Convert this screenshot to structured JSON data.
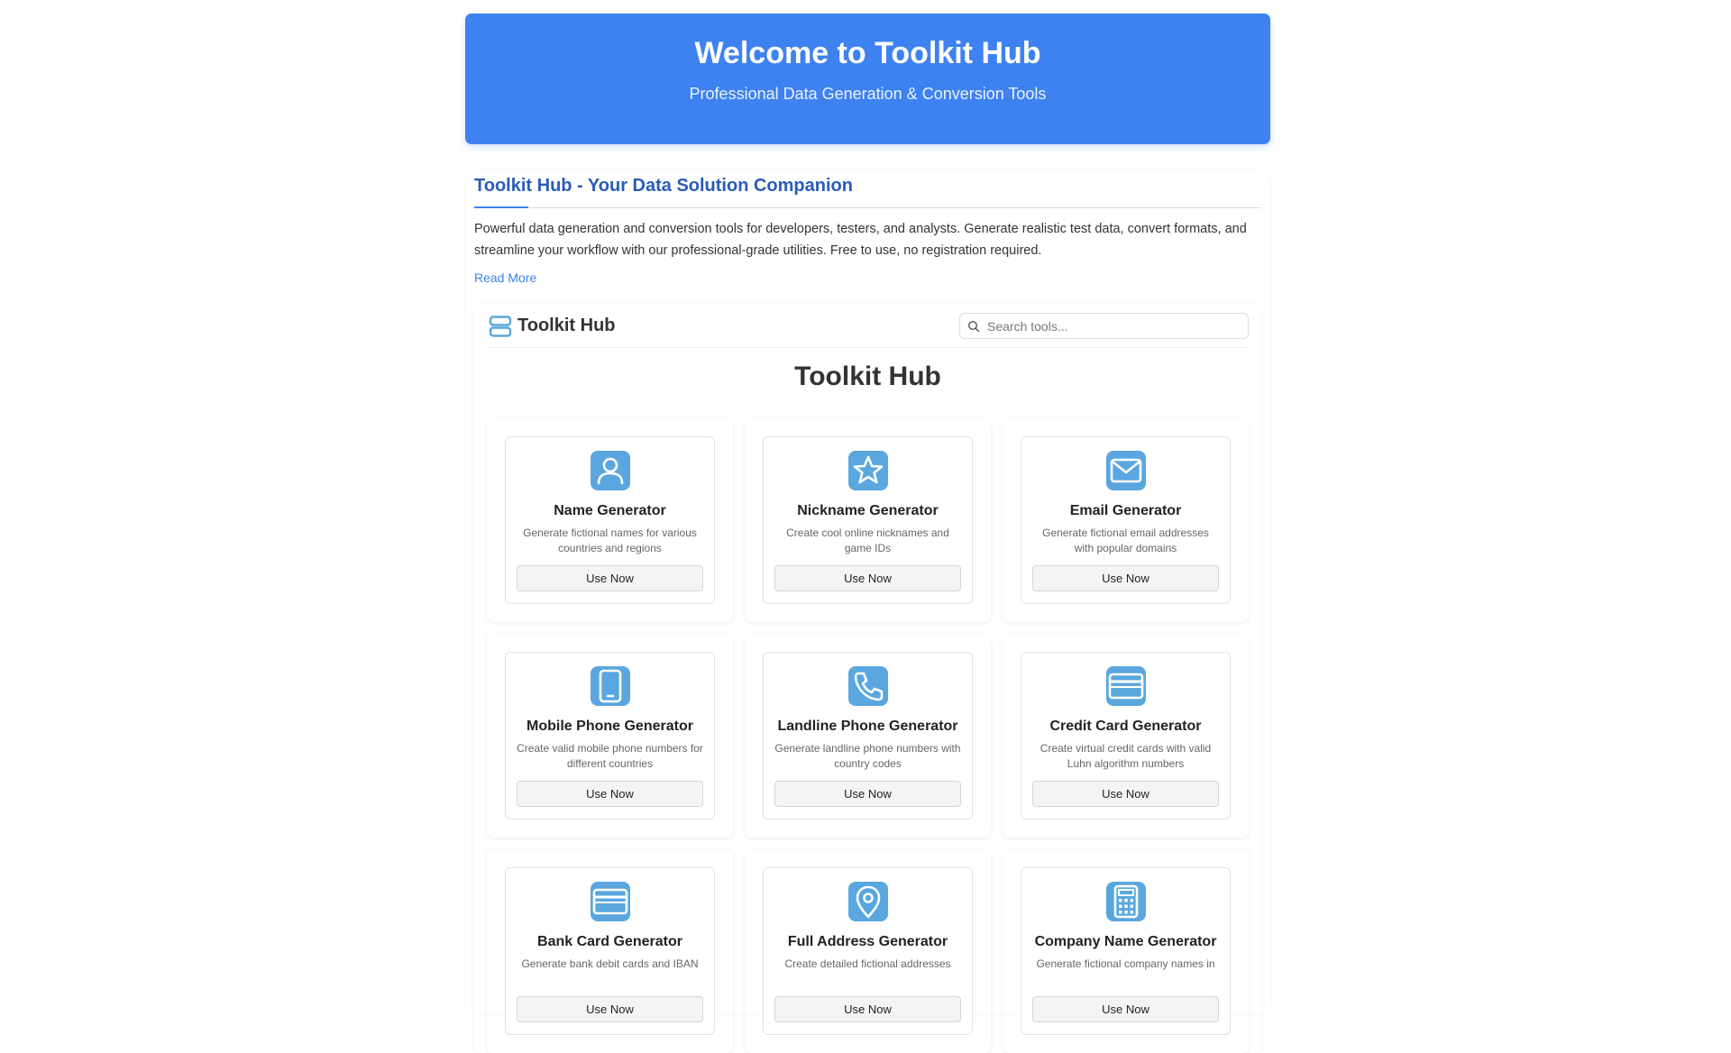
{
  "hero": {
    "title": "Welcome to Toolkit Hub",
    "subtitle": "Professional Data Generation & Conversion Tools"
  },
  "intro": {
    "title": "Toolkit Hub - Your Data Solution Companion",
    "text": "Powerful data generation and conversion tools for developers, testers, and analysts. Generate realistic test data, convert formats, and streamline your workflow with our professional-grade utilities. Free to use, no registration required.",
    "read_more": "Read More"
  },
  "app": {
    "brand": "Toolkit Hub",
    "search_placeholder": "Search tools...",
    "title": "Toolkit Hub"
  },
  "tools": [
    {
      "icon": "user-icon",
      "title": "Name Generator",
      "desc": "Generate fictional names for various countries and regions",
      "button": "Use Now"
    },
    {
      "icon": "star-icon",
      "title": "Nickname Generator",
      "desc": "Create cool online nicknames and game IDs",
      "button": "Use Now"
    },
    {
      "icon": "envelope-icon",
      "title": "Email Generator",
      "desc": "Generate fictional email addresses with popular domains",
      "button": "Use Now"
    },
    {
      "icon": "tablet-icon",
      "title": "Mobile Phone Generator",
      "desc": "Create valid mobile phone numbers for different countries",
      "button": "Use Now"
    },
    {
      "icon": "phone-icon",
      "title": "Landline Phone Generator",
      "desc": "Generate landline phone numbers with country codes",
      "button": "Use Now"
    },
    {
      "icon": "credit-card-icon",
      "title": "Credit Card Generator",
      "desc": "Create virtual credit cards with valid Luhn algorithm numbers",
      "button": "Use Now"
    },
    {
      "icon": "bank-card-icon",
      "title": "Bank Card Generator",
      "desc": "Generate bank debit cards and IBAN",
      "button": "Use Now"
    },
    {
      "icon": "location-pin-icon",
      "title": "Full Address Generator",
      "desc": "Create detailed fictional addresses",
      "button": "Use Now"
    },
    {
      "icon": "calculator-icon",
      "title": "Company Name Generator",
      "desc": "Generate fictional company names in",
      "button": "Use Now"
    }
  ],
  "colors": {
    "primary": "#3d82f0",
    "icon": "#5aa7df",
    "title_blue": "#2a5bb8"
  }
}
